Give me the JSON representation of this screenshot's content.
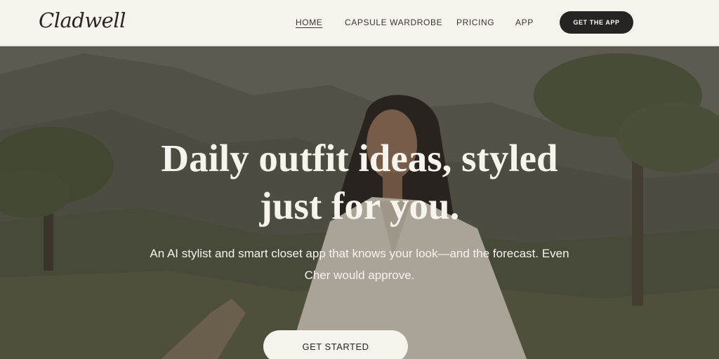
{
  "brand": {
    "logo_text": "Cladwell"
  },
  "nav": {
    "items": [
      {
        "label": "HOME",
        "active": true
      },
      {
        "label": "CAPSULE WARDROBE",
        "active": false
      },
      {
        "label": "PRICING",
        "active": false
      },
      {
        "label": "APP",
        "active": false
      }
    ],
    "cta_label": "GET THE APP"
  },
  "hero": {
    "title_line1": "Daily outfit ideas, styled",
    "title_line2": "just for you.",
    "subtitle_line1": "An AI stylist and smart closet app that knows your look—and the forecast. Even",
    "subtitle_line2": "Cher would approve.",
    "cta_label": "GET STARTED",
    "background_image": "woman-in-linen-shirt-landscape"
  },
  "colors": {
    "header_bg": "#f6f2ec",
    "dark_button": "#262322",
    "hero_text": "#f7f4ee"
  }
}
